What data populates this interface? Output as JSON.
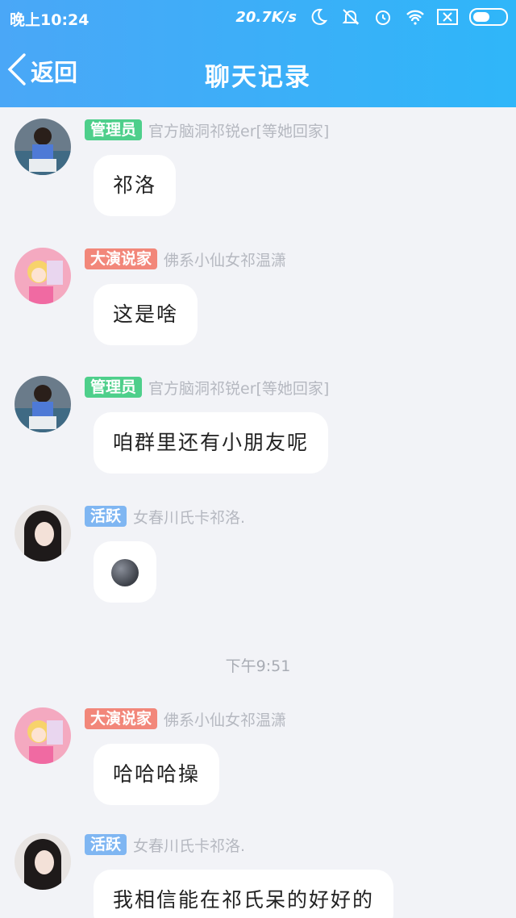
{
  "status_bar": {
    "time": "晚上10:24",
    "speed": "20.7K/s"
  },
  "nav": {
    "back_label": "返回",
    "title": "聊天记录"
  },
  "messages": [
    {
      "badge": "管理员",
      "badge_type": "admin",
      "nick": "官方脑洞祁锐er[等她回家]",
      "text": "祁洛",
      "avatar": "avatar-boy"
    },
    {
      "badge": "大演说家",
      "badge_type": "orator",
      "nick": "佛系小仙女祁温潇",
      "text": "这是啥",
      "avatar": "avatar-girl-cartoon"
    },
    {
      "badge": "管理员",
      "badge_type": "admin",
      "nick": "官方脑洞祁锐er[等她回家]",
      "text": "咱群里还有小朋友呢",
      "avatar": "avatar-boy"
    },
    {
      "badge": "活跃",
      "badge_type": "active",
      "nick": "女春川氏卡祁洛.",
      "text": "",
      "emoji": "new-moon-face",
      "avatar": "avatar-girl-dark-hair"
    },
    {
      "badge": "大演说家",
      "badge_type": "orator",
      "nick": "佛系小仙女祁温潇",
      "text": "哈哈哈操",
      "avatar": "avatar-girl-cartoon"
    },
    {
      "badge": "活跃",
      "badge_type": "active",
      "nick": "女春川氏卡祁洛.",
      "text": "我相信能在祁氏呆的好好的",
      "avatar": "avatar-girl-dark-hair"
    }
  ],
  "timestamp": "下午9:51",
  "colors": {
    "header_start": "#4aa7f7",
    "header_end": "#2fb6f9",
    "admin_badge": "#4ecf8b",
    "orator_badge": "#f2877a",
    "active_badge": "#7fb6f2"
  }
}
